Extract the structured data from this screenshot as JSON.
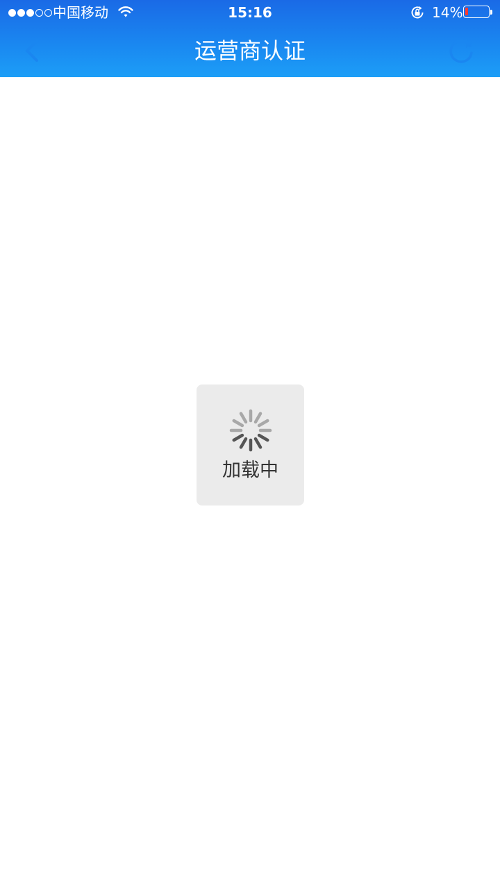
{
  "status_bar": {
    "signal_bars": 3,
    "signal_total": 5,
    "carrier": "中国移动",
    "time": "15:16",
    "battery_percent_text": "14%",
    "battery_level": 0.14,
    "icons": [
      "signal-dots-icon",
      "wifi-icon",
      "rotation-lock-icon",
      "battery-icon"
    ]
  },
  "nav": {
    "title": "运营商认证",
    "back_icon": "chevron-left-icon",
    "refresh_icon": "refresh-icon"
  },
  "loading": {
    "text": "加载中",
    "icon": "spinner-icon"
  },
  "colors": {
    "header_top": "#1a6ae6",
    "header_bottom": "#1c9ef7",
    "nav_icon": "#1a86f0",
    "toast_bg": "#ebebeb",
    "toast_text": "#333333",
    "battery_low": "#ff3b30"
  }
}
